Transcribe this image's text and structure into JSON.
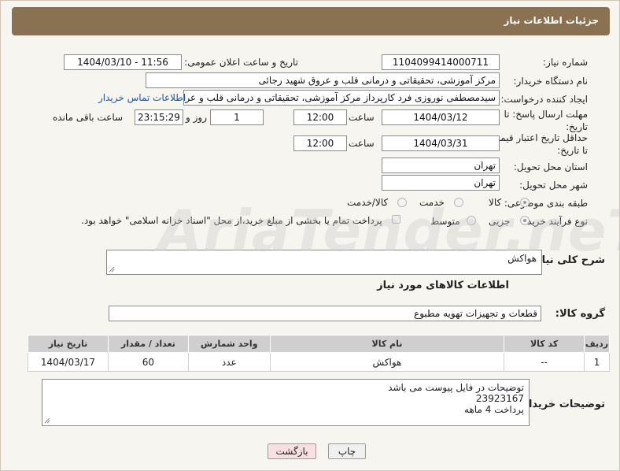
{
  "header": {
    "title": "جزئیات اطلاعات نیاز"
  },
  "fields": {
    "need_number_label": "شماره نیاز:",
    "need_number": "1104099414000711",
    "announce_label": "تاریخ و ساعت اعلان عمومی:",
    "announce_value": "1404/03/10 - 11:56",
    "buyer_org_label": "نام دستگاه خریدار:",
    "buyer_org": "مرکز آموزشی، تحقیقاتی و درمانی قلب و عروق شهید رجائی",
    "creator_label": "ایجاد کننده درخواست:",
    "creator": "سیدمصطفی نوروزی فرد کارپرداز مرکز آموزشی، تحقیقاتی و درمانی قلب و عروق",
    "contact_link": "اطلاعات تماس خریدار",
    "deadline_label": "مهلت ارسال پاسخ: تا تاریخ:",
    "deadline_date": "1404/03/12",
    "time_word": "ساعت",
    "deadline_time": "12:00",
    "days_value": "1",
    "days_word": "روز و",
    "remaining_time": "23:15:29",
    "remaining_word": "ساعت باقی مانده",
    "validity_label": "حداقل تاریخ اعتبار قیمت: تا تاریخ:",
    "validity_date": "1404/03/31",
    "validity_time": "12:00",
    "province_label": "استان محل تحویل:",
    "province": "تهران",
    "city_label": "شهر محل تحویل:",
    "city": "تهران",
    "category_label": "طبقه بندی موضوعی:",
    "cat_goods": "کالا",
    "cat_service": "خدمت",
    "cat_both": "کالا/خدمت",
    "process_label": "نوع فرآیند خرید :",
    "proc_partial": "جزیی",
    "proc_medium": "متوسط",
    "payment_note": "پرداخت تمام یا بخشی از مبلغ خرید،از محل \"اسناد خزانه اسلامی\" خواهد بود."
  },
  "description": {
    "label": "شرح کلی نیاز:",
    "value": "هواکش"
  },
  "goods_info_title": "اطلاعات کالاهای مورد نیاز",
  "goods_group": {
    "label": "گروه کالا:",
    "value": "قطعات و تجهیزات تهویه مطبوع"
  },
  "table": {
    "headers": [
      "ردیف",
      "کد کالا",
      "نام کالا",
      "واحد شمارش",
      "تعداد / مقدار",
      "تاریخ نیاز"
    ],
    "rows": [
      [
        "1",
        "--",
        "هواکش",
        "عدد",
        "60",
        "1404/03/17"
      ]
    ]
  },
  "buyer_notes": {
    "label": "توضیحات خریدار:",
    "line1": "توضیحات در فایل پیوست می باشد",
    "line2": "23923167",
    "line3": "پرداخت 4 ماهه"
  },
  "buttons": {
    "print": "چاپ",
    "back": "بازگشت"
  },
  "watermark": "AriaTender.neT"
}
